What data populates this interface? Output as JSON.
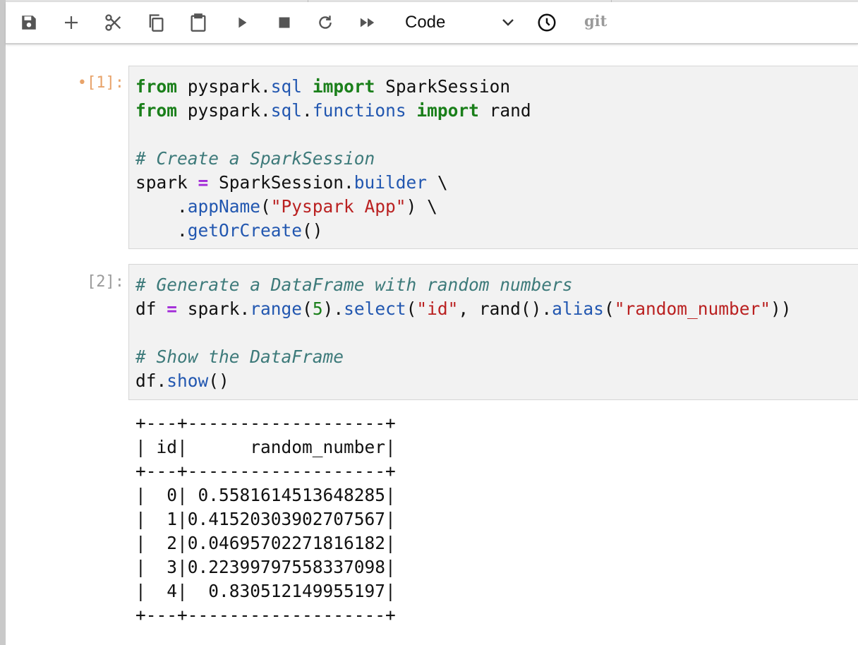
{
  "toolbar": {
    "buttons": [
      "save",
      "insert-cell",
      "cut",
      "copy",
      "paste",
      "run",
      "interrupt",
      "restart",
      "restart-run-all"
    ],
    "cell_type": "Code",
    "git_label": "git"
  },
  "cells": [
    {
      "prompt": "[1]:",
      "active": true,
      "lines": [
        [
          [
            "kw",
            "from"
          ],
          [
            "t",
            " pyspark."
          ],
          [
            "attr",
            "sql"
          ],
          [
            "t",
            " "
          ],
          [
            "kw",
            "import"
          ],
          [
            "t",
            " SparkSession"
          ]
        ],
        [
          [
            "kw",
            "from"
          ],
          [
            "t",
            " pyspark."
          ],
          [
            "attr",
            "sql"
          ],
          [
            "t",
            "."
          ],
          [
            "attr",
            "functions"
          ],
          [
            "t",
            " "
          ],
          [
            "kw",
            "import"
          ],
          [
            "t",
            " rand"
          ]
        ],
        [],
        [
          [
            "cm",
            "# Create a SparkSession"
          ]
        ],
        [
          [
            "t",
            "spark "
          ],
          [
            "op",
            "="
          ],
          [
            "t",
            " SparkSession."
          ],
          [
            "attr",
            "builder"
          ],
          [
            "t",
            " \\"
          ]
        ],
        [
          [
            "t",
            "    ."
          ],
          [
            "attr",
            "appName"
          ],
          [
            "t",
            "("
          ],
          [
            "str",
            "\"Pyspark App\""
          ],
          [
            "t",
            ") \\"
          ]
        ],
        [
          [
            "t",
            "    ."
          ],
          [
            "attr",
            "getOrCreate"
          ],
          [
            "t",
            "()"
          ]
        ]
      ]
    },
    {
      "prompt": "[2]:",
      "active": false,
      "lines": [
        [
          [
            "cm",
            "# Generate a DataFrame with random numbers"
          ]
        ],
        [
          [
            "t",
            "df "
          ],
          [
            "op",
            "="
          ],
          [
            "t",
            " spark."
          ],
          [
            "attr",
            "range"
          ],
          [
            "t",
            "("
          ],
          [
            "num",
            "5"
          ],
          [
            "t",
            ")."
          ],
          [
            "attr",
            "select"
          ],
          [
            "t",
            "("
          ],
          [
            "str",
            "\"id\""
          ],
          [
            "t",
            ", rand()."
          ],
          [
            "attr",
            "alias"
          ],
          [
            "t",
            "("
          ],
          [
            "str",
            "\"random_number\""
          ],
          [
            "t",
            "))"
          ]
        ],
        [],
        [
          [
            "cm",
            "# Show the DataFrame"
          ]
        ],
        [
          [
            "t",
            "df."
          ],
          [
            "attr",
            "show"
          ],
          [
            "t",
            "()"
          ]
        ]
      ]
    }
  ],
  "output": {
    "lines": [
      "+---+-------------------+",
      "| id|      random_number|",
      "+---+-------------------+",
      "|  0| 0.5581614513648285|",
      "|  1|0.41520303902707567|",
      "|  2|0.04695702271816182|",
      "|  3|0.22399797558337098|",
      "|  4|  0.830512149955197|",
      "+---+-------------------+"
    ]
  }
}
